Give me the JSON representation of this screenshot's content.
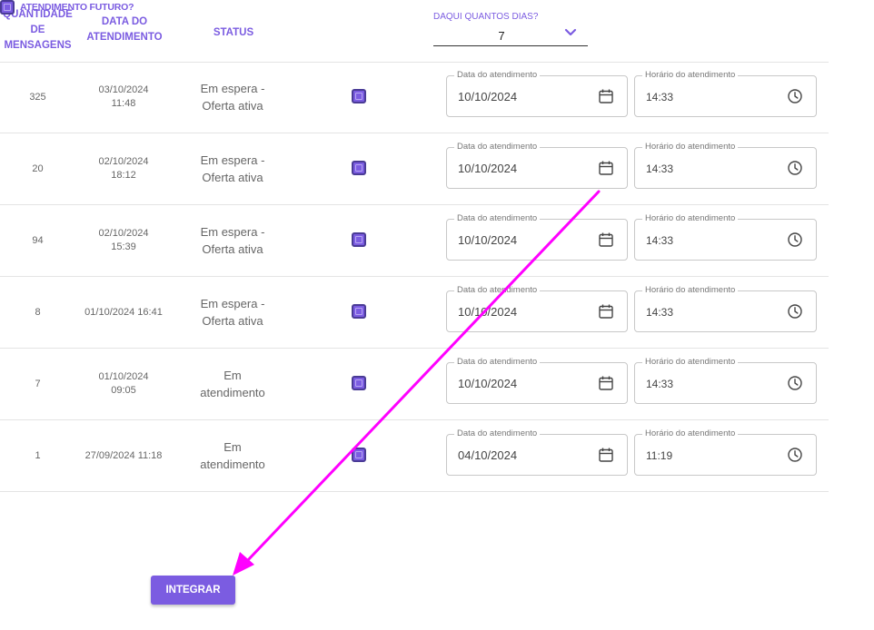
{
  "header": {
    "qty_label": "QUANTIDADE\nDE\nMENSAGENS",
    "date_label": "DATA DO\nATENDIMENTO",
    "status_label": "STATUS",
    "future_label": "ATENDIMENTO FUTURO?",
    "days_label": "DAQUI QUANTOS DIAS?",
    "days_value": "7"
  },
  "field_labels": {
    "date": "Data do atendimento",
    "time": "Horário do atendimento"
  },
  "rows": [
    {
      "qty": "325",
      "date": "03/10/2024\n11:48",
      "status": "Em espera -\nOferta ativa",
      "appt_date": "10/10/2024",
      "appt_time": "14:33"
    },
    {
      "qty": "20",
      "date": "02/10/2024\n18:12",
      "status": "Em espera -\nOferta ativa",
      "appt_date": "10/10/2024",
      "appt_time": "14:33"
    },
    {
      "qty": "94",
      "date": "02/10/2024\n15:39",
      "status": "Em espera -\nOferta ativa",
      "appt_date": "10/10/2024",
      "appt_time": "14:33"
    },
    {
      "qty": "8",
      "date": "01/10/2024 16:41",
      "status": "Em espera -\nOferta ativa",
      "appt_date": "10/10/2024",
      "appt_time": "14:33"
    },
    {
      "qty": "7",
      "date": "01/10/2024\n09:05",
      "status": "Em\natendimento",
      "appt_date": "10/10/2024",
      "appt_time": "14:33"
    },
    {
      "qty": "1",
      "date": "27/09/2024 11:18",
      "status": "Em\natendimento",
      "appt_date": "04/10/2024",
      "appt_time": "11:19"
    }
  ],
  "actions": {
    "integrate_label": "INTEGRAR"
  },
  "colors": {
    "accent": "#7b5ce1",
    "annotation_arrow": "#ff00ff"
  },
  "icons": {
    "calendar": "calendar-icon",
    "clock": "clock-icon",
    "dropdown": "chevron-down-icon"
  }
}
